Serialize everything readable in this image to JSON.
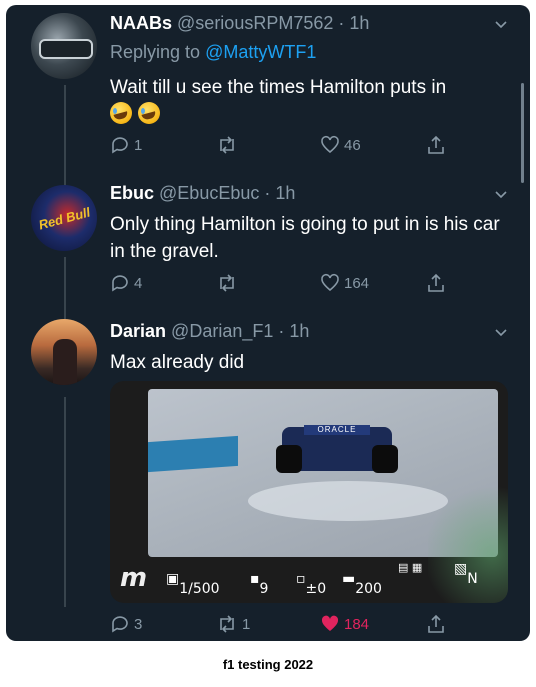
{
  "tweets": [
    {
      "name": "NAABs",
      "handle": "@seriousRPM7562",
      "time": "· 1h",
      "replying_prefix": "Replying to",
      "replying_to": "@MattyWTF1",
      "text": "Wait till u see the times Hamilton puts in",
      "emojis": [
        "rolling-on-floor-laughing-emoji",
        "rolling-on-floor-laughing-emoji"
      ],
      "replies": "1",
      "retweets": "",
      "likes": "46",
      "liked": false
    },
    {
      "name": "Ebuc",
      "handle": "@EbucEbuc",
      "time": "· 1h",
      "text": "Only thing Hamilton is going to put in is his car in the gravel.",
      "replies": "4",
      "retweets": "",
      "likes": "164",
      "liked": false
    },
    {
      "name": "Darian",
      "handle": "@Darian_F1",
      "time": "· 1h",
      "text": "Max already did",
      "replies": "3",
      "retweets": "1",
      "likes": "184",
      "liked": true,
      "media": {
        "wing_text": "ORACLE",
        "hud": {
          "logo": "m",
          "shutter": "1/500",
          "aperture": "9",
          "exposure": "±0",
          "iso": "200",
          "mode": "N"
        }
      }
    }
  ],
  "caption": "f1 testing 2022",
  "colors": {
    "background": "#15202b",
    "text": "#ffffff",
    "muted": "#8899a6",
    "link": "#1da1f2",
    "like": "#e0245e"
  }
}
